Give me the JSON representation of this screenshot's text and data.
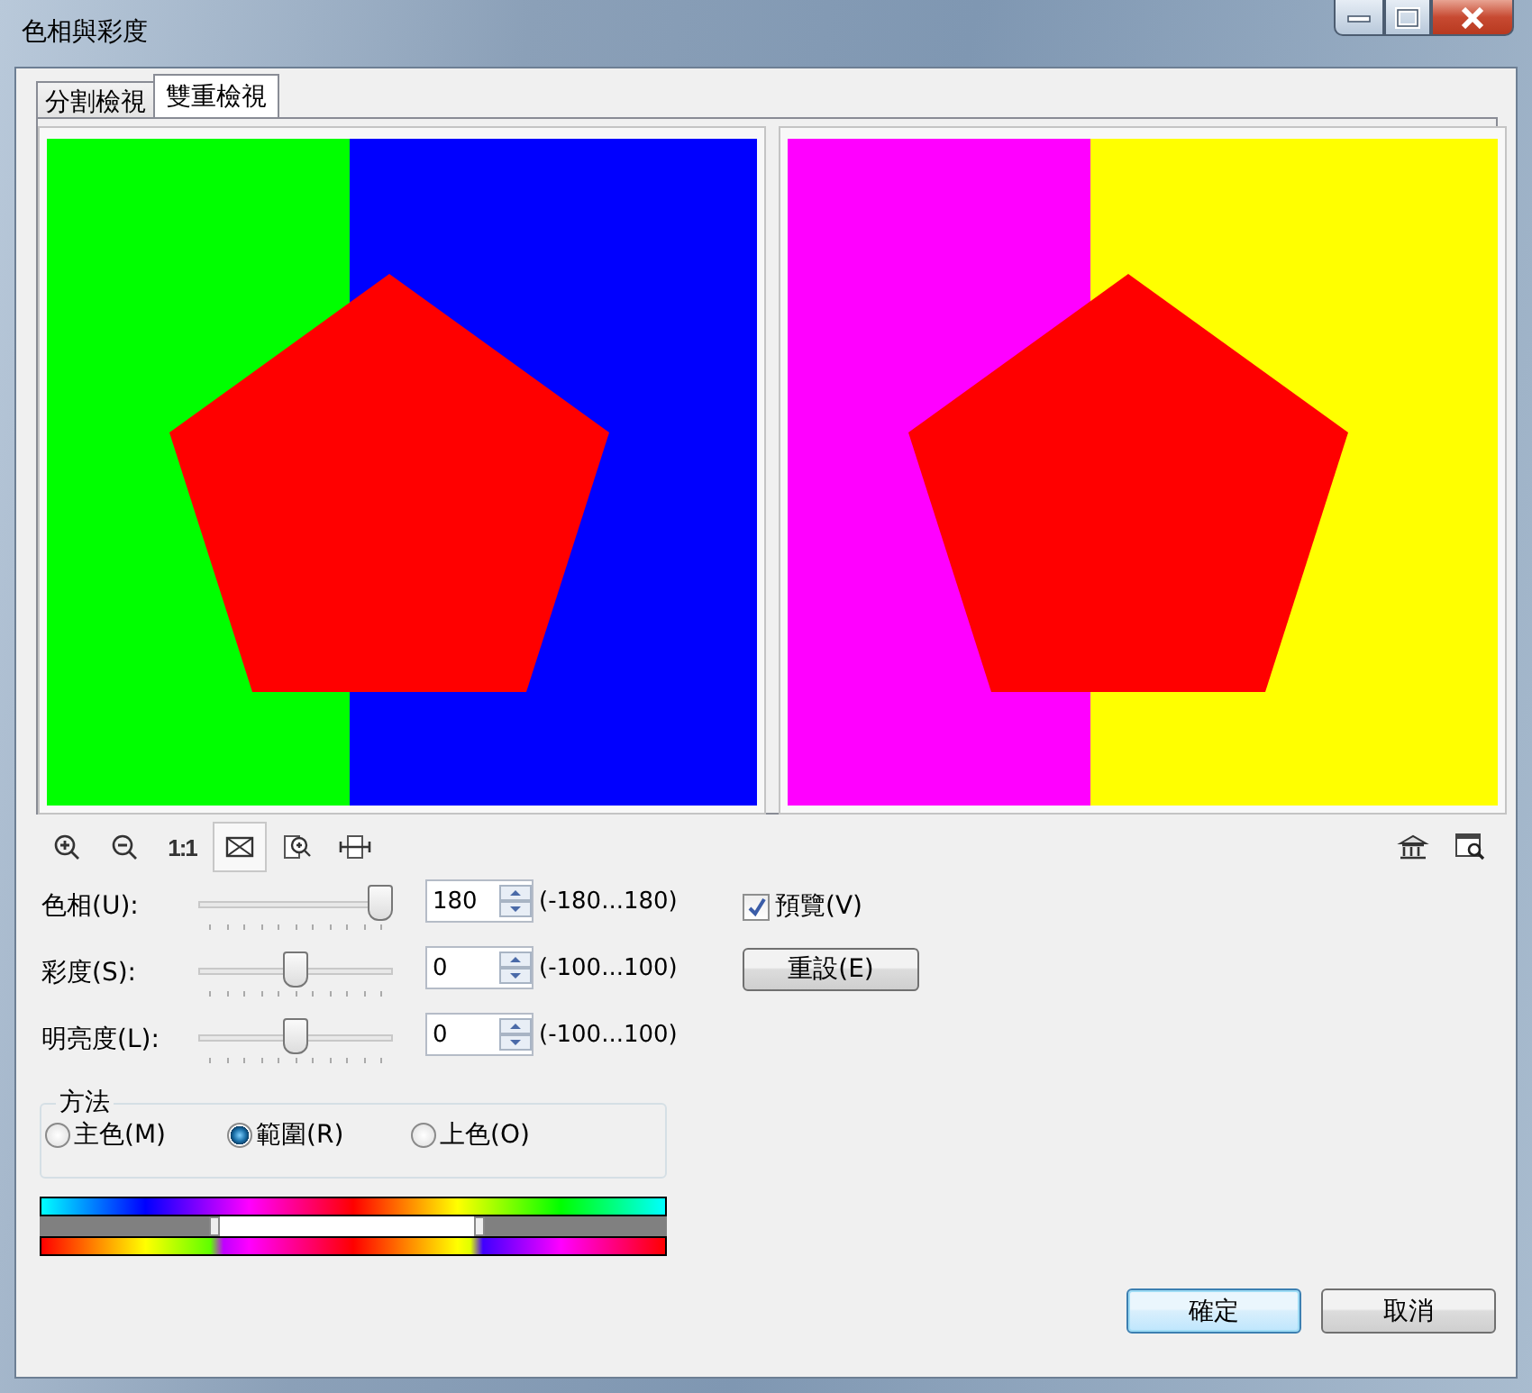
{
  "window": {
    "title": "色相與彩度"
  },
  "tabs": [
    {
      "label": "分割檢視",
      "selected": false
    },
    {
      "label": "雙重檢視",
      "selected": true
    }
  ],
  "tools": [
    {
      "kind": "zoom-in",
      "selected": false
    },
    {
      "kind": "zoom-out",
      "selected": false
    },
    {
      "kind": "actual-size",
      "label": "1:1",
      "selected": false
    },
    {
      "kind": "fit",
      "selected": true
    },
    {
      "kind": "zoom-area",
      "selected": false
    },
    {
      "kind": "pan",
      "selected": false
    }
  ],
  "side_tools": [
    {
      "kind": "split"
    },
    {
      "kind": "preview"
    }
  ],
  "adjustments": [
    {
      "label": "色相(U):",
      "value": "180",
      "range": "(-180...180)",
      "level": 1
    },
    {
      "label": "彩度(S):",
      "value": "0",
      "range": "(-100...100)",
      "level": 0.5
    },
    {
      "label": "明亮度(L):",
      "value": "0",
      "range": "(-100...100)",
      "level": 0.5
    }
  ],
  "preview": {
    "label": "預覽(V)",
    "checked": true
  },
  "reset_button": "重設(E)",
  "method": {
    "title": "方法",
    "options": [
      {
        "label": "主色(M)",
        "selected": false
      },
      {
        "label": "範圍(R)",
        "selected": true
      },
      {
        "label": "上色(O)",
        "selected": false
      }
    ]
  },
  "range": {
    "handles": [
      {
        "level": 0.28
      },
      {
        "level": 0.7
      }
    ]
  },
  "buttons": [
    {
      "label": "確定",
      "kind": "default"
    },
    {
      "label": "取消",
      "kind": "normal"
    }
  ]
}
